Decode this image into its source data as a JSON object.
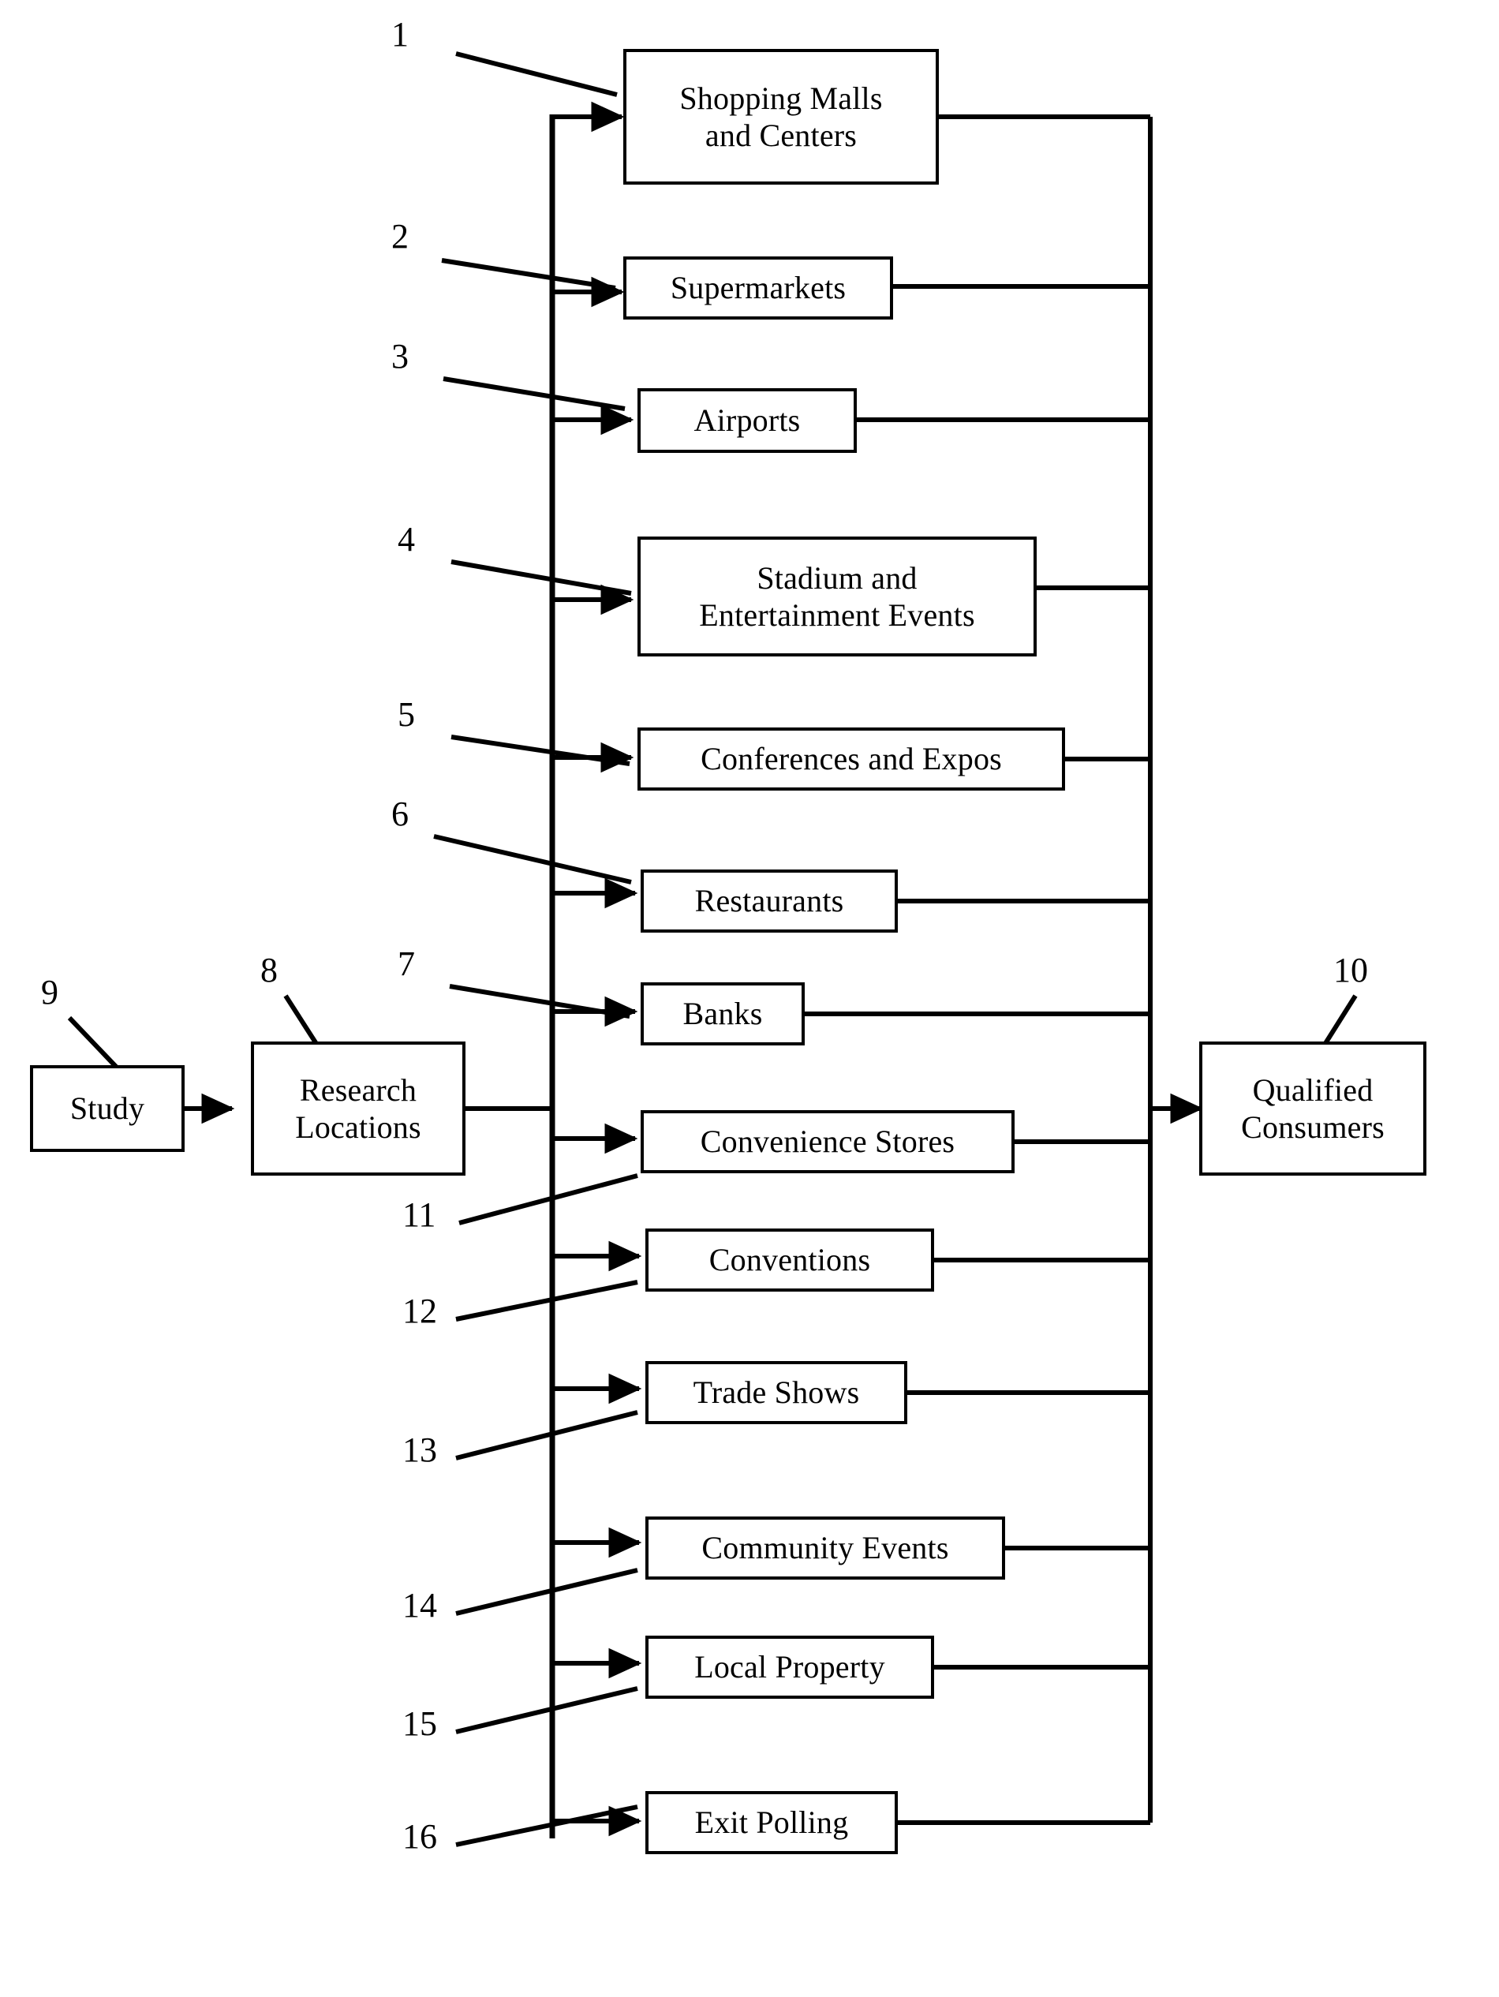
{
  "figure": {
    "type": "patent-flow-diagram",
    "background_color": "#ffffff",
    "line_color": "#000000"
  },
  "nodes": {
    "study": {
      "ref": "9",
      "label": "Study"
    },
    "research_locations": {
      "ref": "8",
      "label": "Research\nLocations"
    },
    "qualified_consumers": {
      "ref": "10",
      "label": "Qualified\nConsumers"
    },
    "shopping_malls": {
      "ref": "1",
      "label": "Shopping Malls\nand Centers"
    },
    "supermarkets": {
      "ref": "2",
      "label": "Supermarkets"
    },
    "airports": {
      "ref": "3",
      "label": "Airports"
    },
    "stadium_events": {
      "ref": "4",
      "label": "Stadium and\nEntertainment Events"
    },
    "conferences_expos": {
      "ref": "5",
      "label": "Conferences and Expos"
    },
    "restaurants": {
      "ref": "6",
      "label": "Restaurants"
    },
    "banks": {
      "ref": "7",
      "label": "Banks"
    },
    "convenience_stores": {
      "ref": "11",
      "label": "Convenience Stores"
    },
    "conventions": {
      "ref": "12",
      "label": "Conventions"
    },
    "trade_shows": {
      "ref": "13",
      "label": "Trade Shows"
    },
    "community_events": {
      "ref": "14",
      "label": "Community Events"
    },
    "local_property": {
      "ref": "15",
      "label": "Local Property"
    },
    "exit_polling": {
      "ref": "16",
      "label": "Exit Polling"
    }
  },
  "reference_numerals": {
    "n1": "1",
    "n2": "2",
    "n3": "3",
    "n4": "4",
    "n5": "5",
    "n6": "6",
    "n7": "7",
    "n8": "8",
    "n9": "9",
    "n10": "10",
    "n11": "11",
    "n12": "12",
    "n13": "13",
    "n14": "14",
    "n15": "15",
    "n16": "16"
  }
}
